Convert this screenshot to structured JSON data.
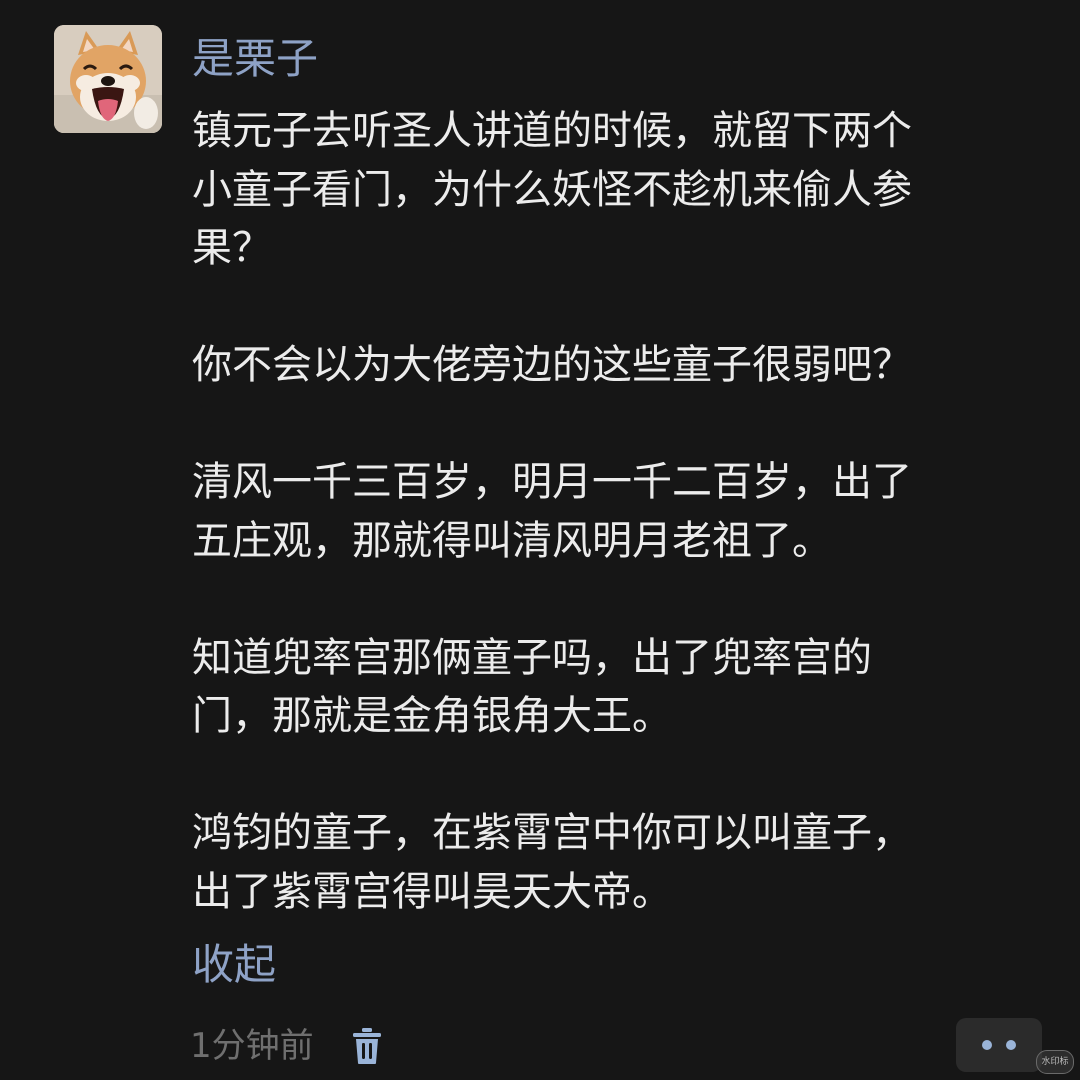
{
  "comment": {
    "username": "是栗子",
    "avatar_icon": "shiba-dog-avatar",
    "paragraphs": [
      "镇元子去听圣人讲道的时候，就留下两个\n小童子看门，为什么妖怪不趁机来偷人参\n果？",
      "你不会以为大佬旁边的这些童子很弱吧？",
      "清风一千三百岁，明月一千二百岁，出了\n五庄观，那就得叫清风明月老祖了。",
      "知道兜率宫那俩童子吗，出了兜率宫的\n门，那就是金角银角大王。",
      "鸿钧的童子，在紫霄宫中你可以叫童子，\n出了紫霄宫得叫昊天大帝。"
    ],
    "collapse_label": "收起",
    "time": "1分钟前",
    "delete_icon": "trash-icon",
    "more_icon": "more-dots-icon"
  },
  "watermark": "水印标",
  "colors": {
    "background": "#161616",
    "link": "#8ea2c6",
    "text": "#ececec",
    "muted": "#6f6f6f"
  }
}
